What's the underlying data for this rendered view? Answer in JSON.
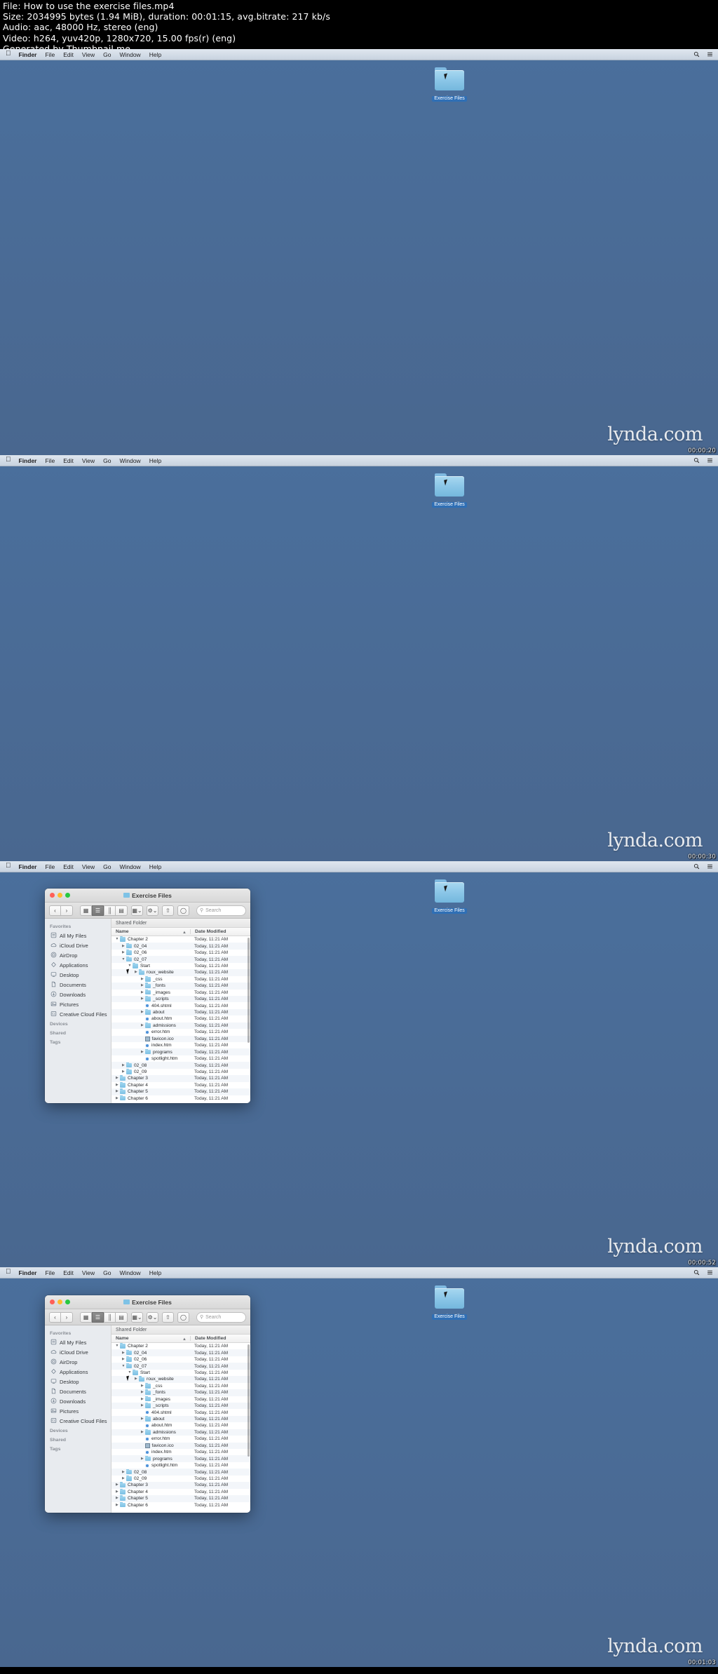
{
  "meta": {
    "line1": "File: How to use the exercise files.mp4",
    "line2": "Size: 2034995 bytes (1.94 MiB), duration: 00:01:15, avg.bitrate: 217 kb/s",
    "line3": "Audio: aac, 48000 Hz, stereo (eng)",
    "line4": "Video: h264, yuv420p, 1280x720, 15.00 fps(r) (eng)",
    "line5": "Generated by Thumbnail me"
  },
  "menubar": {
    "apple_glyph": "",
    "items": [
      "Finder",
      "File",
      "Edit",
      "View",
      "Go",
      "Window",
      "Help"
    ],
    "right_icons": [
      "search-icon",
      "list-icon"
    ]
  },
  "desktop": {
    "icon_label": "Exercise Files"
  },
  "watermark": {
    "text": "lynda",
    "suffix": ".com"
  },
  "frames": [
    {
      "timestamp": "00:00:20",
      "has_window": false
    },
    {
      "timestamp": "00:00:30",
      "has_window": false
    },
    {
      "timestamp": "00:00:52",
      "has_window": true
    },
    {
      "timestamp": "00:01:03",
      "has_window": true
    }
  ],
  "finder": {
    "title": "Exercise Files",
    "search_placeholder": "Search",
    "pathbar_label": "Shared Folder",
    "columns": [
      "Name",
      "Date Modified"
    ],
    "sort_arrow": "▲",
    "toolbar": {
      "back": "‹",
      "forward": "›",
      "view_icon": "icon-view",
      "view_list": "list-view",
      "view_column": "column-view",
      "view_cover": "coverflow-view",
      "arrange": "arrange-button",
      "action": "⚙",
      "share": "share-button",
      "tag": "tag-button",
      "chevron": "⌄"
    },
    "sidebar": [
      {
        "type": "header",
        "label": "Favorites"
      },
      {
        "type": "item",
        "label": "All My Files",
        "icon": "all-my-files-icon"
      },
      {
        "type": "item",
        "label": "iCloud Drive",
        "icon": "icloud-icon"
      },
      {
        "type": "item",
        "label": "AirDrop",
        "icon": "airdrop-icon"
      },
      {
        "type": "item",
        "label": "Applications",
        "icon": "applications-icon"
      },
      {
        "type": "item",
        "label": "Desktop",
        "icon": "desktop-icon"
      },
      {
        "type": "item",
        "label": "Documents",
        "icon": "documents-icon"
      },
      {
        "type": "item",
        "label": "Downloads",
        "icon": "downloads-icon"
      },
      {
        "type": "item",
        "label": "Pictures",
        "icon": "pictures-icon"
      },
      {
        "type": "item",
        "label": "Creative Cloud Files",
        "icon": "creative-cloud-icon"
      },
      {
        "type": "header",
        "label": "Devices"
      },
      {
        "type": "header",
        "label": "Shared"
      },
      {
        "type": "header",
        "label": "Tags"
      }
    ],
    "rows": [
      {
        "name": "Chapter 2",
        "modified": "Today, 11:21 AM",
        "indent": 0,
        "twisty": "▼",
        "kind": "folder"
      },
      {
        "name": "02_04",
        "modified": "Today, 11:21 AM",
        "indent": 1,
        "twisty": "▶",
        "kind": "folder"
      },
      {
        "name": "02_06",
        "modified": "Today, 11:21 AM",
        "indent": 1,
        "twisty": "▶",
        "kind": "folder"
      },
      {
        "name": "02_07",
        "modified": "Today, 11:21 AM",
        "indent": 1,
        "twisty": "▼",
        "kind": "folder"
      },
      {
        "name": "Start",
        "modified": "Today, 11:21 AM",
        "indent": 2,
        "twisty": "▼",
        "kind": "folder"
      },
      {
        "name": "roux_website",
        "modified": "Today, 11:21 AM",
        "indent": 3,
        "twisty": "▶",
        "kind": "folder"
      },
      {
        "name": "_css",
        "modified": "Today, 11:21 AM",
        "indent": 4,
        "twisty": "▶",
        "kind": "folder"
      },
      {
        "name": "_fonts",
        "modified": "Today, 11:21 AM",
        "indent": 4,
        "twisty": "▶",
        "kind": "folder"
      },
      {
        "name": "_images",
        "modified": "Today, 11:21 AM",
        "indent": 4,
        "twisty": "▶",
        "kind": "folder"
      },
      {
        "name": "_scripts",
        "modified": "Today, 11:21 AM",
        "indent": 4,
        "twisty": "▶",
        "kind": "folder"
      },
      {
        "name": "404.shtml",
        "modified": "Today, 11:21 AM",
        "indent": 4,
        "twisty": "",
        "kind": "doc"
      },
      {
        "name": "about",
        "modified": "Today, 11:21 AM",
        "indent": 4,
        "twisty": "▶",
        "kind": "folder"
      },
      {
        "name": "about.htm",
        "modified": "Today, 11:21 AM",
        "indent": 4,
        "twisty": "",
        "kind": "doc"
      },
      {
        "name": "admissions",
        "modified": "Today, 11:21 AM",
        "indent": 4,
        "twisty": "▶",
        "kind": "folder"
      },
      {
        "name": "error.htm",
        "modified": "Today, 11:21 AM",
        "indent": 4,
        "twisty": "",
        "kind": "doc"
      },
      {
        "name": "favicon.ico",
        "modified": "Today, 11:21 AM",
        "indent": 4,
        "twisty": "",
        "kind": "ico"
      },
      {
        "name": "index.htm",
        "modified": "Today, 11:21 AM",
        "indent": 4,
        "twisty": "",
        "kind": "doc"
      },
      {
        "name": "programs",
        "modified": "Today, 11:21 AM",
        "indent": 4,
        "twisty": "▶",
        "kind": "folder"
      },
      {
        "name": "spotlight.htm",
        "modified": "Today, 11:21 AM",
        "indent": 4,
        "twisty": "",
        "kind": "doc"
      },
      {
        "name": "02_08",
        "modified": "Today, 11:21 AM",
        "indent": 1,
        "twisty": "▶",
        "kind": "folder"
      },
      {
        "name": "02_09",
        "modified": "Today, 11:21 AM",
        "indent": 1,
        "twisty": "▶",
        "kind": "folder"
      },
      {
        "name": "Chapter 3",
        "modified": "Today, 11:21 AM",
        "indent": 0,
        "twisty": "▶",
        "kind": "folder"
      },
      {
        "name": "Chapter 4",
        "modified": "Today, 11:21 AM",
        "indent": 0,
        "twisty": "▶",
        "kind": "folder"
      },
      {
        "name": "Chapter 5",
        "modified": "Today, 11:21 AM",
        "indent": 0,
        "twisty": "▶",
        "kind": "folder"
      },
      {
        "name": "Chapter 6",
        "modified": "Today, 11:21 AM",
        "indent": 0,
        "twisty": "▶",
        "kind": "folder"
      }
    ]
  }
}
